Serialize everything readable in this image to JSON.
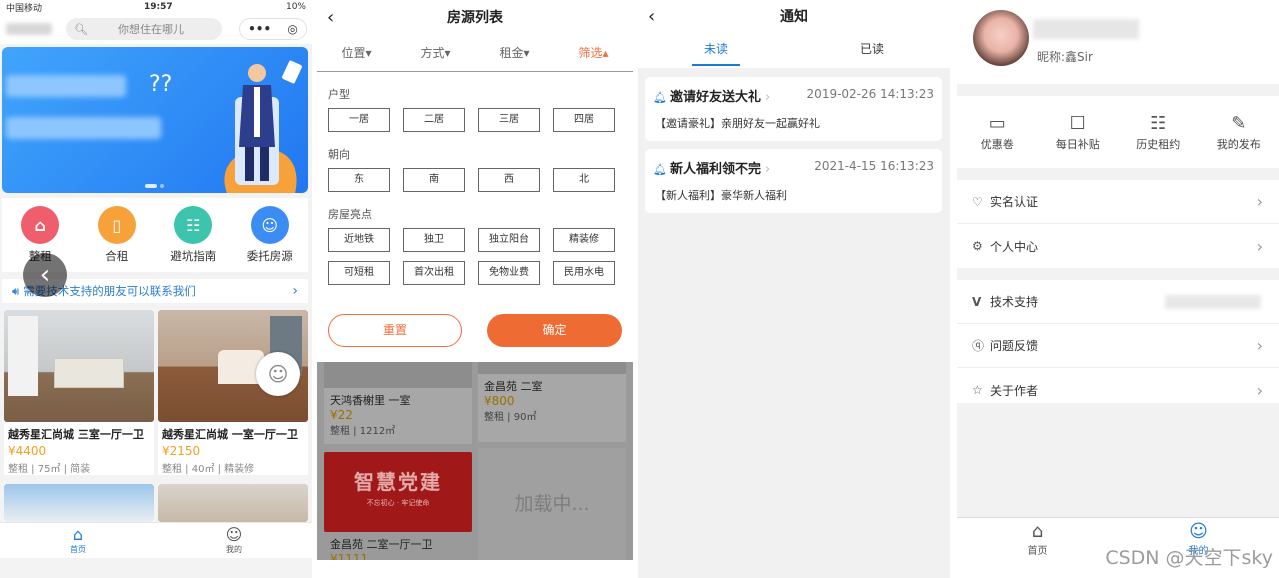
{
  "home": {
    "status": {
      "carrier": "中国移动",
      "time": "19:57",
      "battery": "10%"
    },
    "search_placeholder": "你想住在哪儿",
    "capsule": {
      "menu": "•••",
      "close": "◎"
    },
    "quick": [
      {
        "label": "整租",
        "color": "#f05d6c",
        "icon": "house-icon"
      },
      {
        "label": "合租",
        "color": "#f7a13a",
        "icon": "door-icon"
      },
      {
        "label": "避坑指南",
        "color": "#3dc4ad",
        "icon": "guide-icon"
      },
      {
        "label": "委托房源",
        "color": "#3b8cf3",
        "icon": "agent-icon"
      }
    ],
    "notice": "需要技术支持的朋友可以联系我们",
    "listings": [
      {
        "title": "越秀星汇尚城 三室一厅一卫",
        "price": "¥4400",
        "sub": "整租 | 75㎡ | 简装"
      },
      {
        "title": "越秀星汇尚城 一室一厅一卫",
        "price": "¥2150",
        "sub": "整租 | 40㎡ | 精装修"
      }
    ],
    "tabs": [
      {
        "label": "首页"
      },
      {
        "label": "我的"
      }
    ]
  },
  "filter": {
    "title": "房源列表",
    "tabs": [
      {
        "label": "位置",
        "active": false
      },
      {
        "label": "方式",
        "active": false
      },
      {
        "label": "租金",
        "active": false
      },
      {
        "label": "筛选",
        "active": true
      }
    ],
    "sections": [
      {
        "title": "户型",
        "options": [
          "一居",
          "二居",
          "三居",
          "四居"
        ]
      },
      {
        "title": "朝向",
        "options": [
          "东",
          "南",
          "西",
          "北"
        ]
      },
      {
        "title": "房屋亮点",
        "options": [
          "近地铁",
          "独卫",
          "独立阳台",
          "精装修",
          "可短租",
          "首次出租",
          "免物业费",
          "民用水电"
        ]
      }
    ],
    "reset": "重置",
    "confirm": "确定",
    "behind": [
      {
        "title": "天鸿香榭里 一室",
        "price": "¥22",
        "sub": "整租 | 1212㎡"
      },
      {
        "title": "金昌苑 二室",
        "price": "¥800",
        "sub": "整租 | 90㎡"
      },
      {
        "title": "金昌苑 二室一厅一卫",
        "price": "¥1111",
        "sub": ""
      }
    ],
    "party_banner": {
      "big": "智慧党建",
      "small": "不忘初心 · 牢记使命"
    },
    "loading": "加载中..."
  },
  "notify": {
    "title": "通知",
    "tabs": [
      {
        "label": "未读",
        "active": true
      },
      {
        "label": "已读",
        "active": false
      }
    ],
    "messages": [
      {
        "title": "邀请好友送大礼",
        "date": "2019-02-26 14:13:23",
        "body": "【邀请豪礼】亲朋好友一起赢好礼"
      },
      {
        "title": "新人福利领不完",
        "date": "2021-4-15 16:13:23",
        "body": "【新人福利】豪华新人福利"
      }
    ]
  },
  "mine": {
    "nickname": "昵称:鑫Sir",
    "features": [
      {
        "label": "优惠卷",
        "icon": "ticket-icon"
      },
      {
        "label": "每日补贴",
        "icon": "gift-icon"
      },
      {
        "label": "历史租约",
        "icon": "contract-icon"
      },
      {
        "label": "我的发布",
        "icon": "edit-icon"
      }
    ],
    "group1": [
      {
        "label": "实名认证",
        "icon": "heart-icon"
      },
      {
        "label": "个人中心",
        "icon": "settings-icon"
      }
    ],
    "group2": [
      {
        "label": "技术支持",
        "icon": "v-icon"
      },
      {
        "label": "问题反馈",
        "icon": "question-icon"
      },
      {
        "label": "关于作者",
        "icon": "star-icon"
      }
    ],
    "tabs": [
      {
        "label": "首页"
      },
      {
        "label": "我的"
      }
    ],
    "watermark": "CSDN @天空下sky"
  }
}
